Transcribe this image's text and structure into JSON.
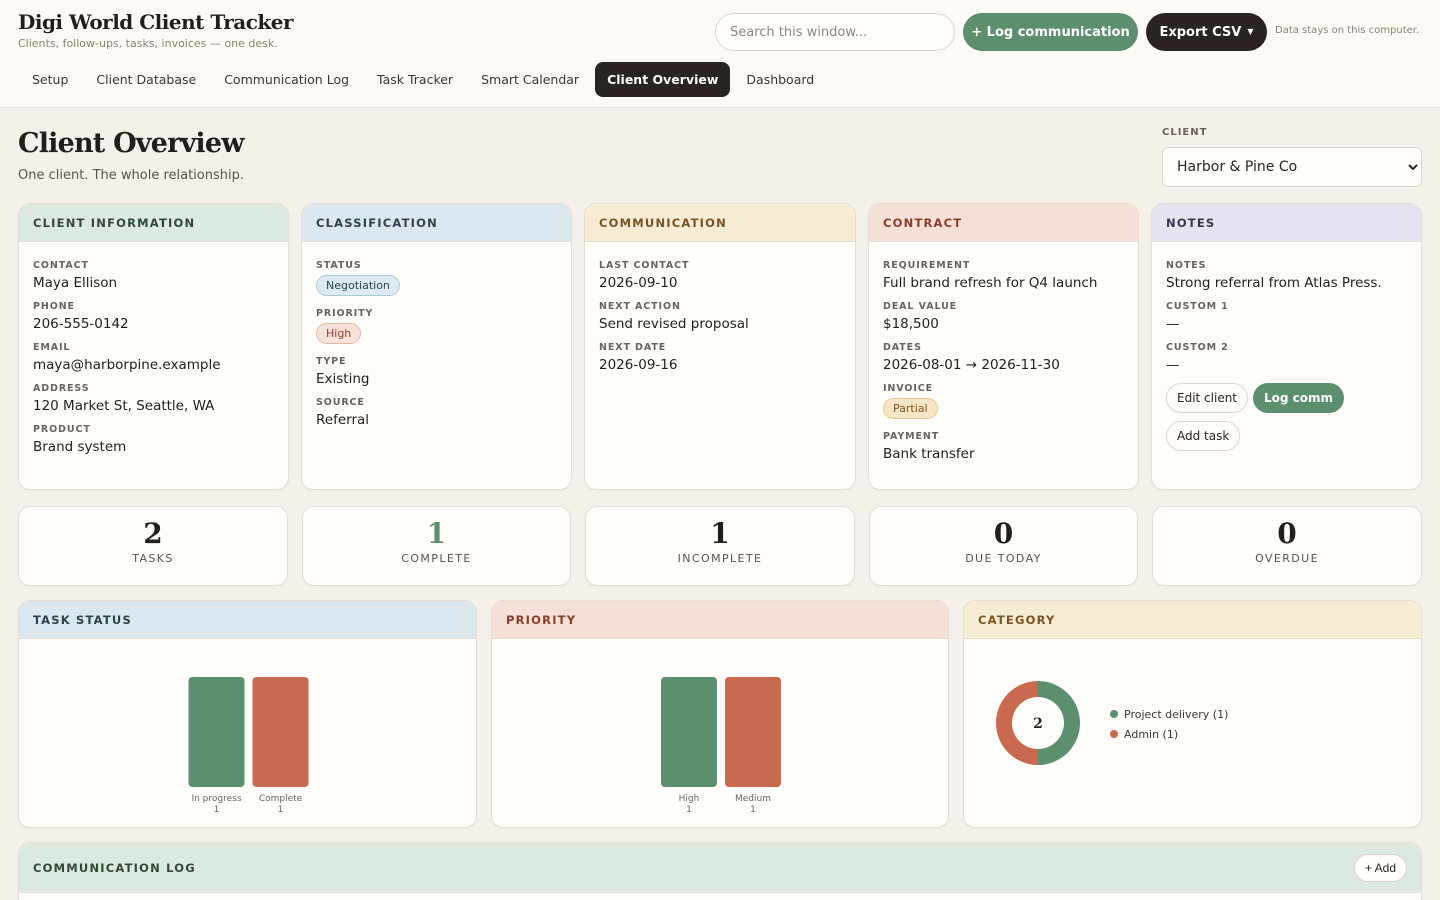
{
  "app": {
    "title": "Digi World Client Tracker",
    "subtitle": "Clients, follow-ups, tasks, invoices — one desk.",
    "search_placeholder": "Search this window...",
    "log_button": "+ Log communication",
    "export_button": "Export CSV",
    "local_note": "Data stays on this computer."
  },
  "nav": [
    {
      "label": "Setup",
      "active": false
    },
    {
      "label": "Client Database",
      "active": false
    },
    {
      "label": "Communication Log",
      "active": false
    },
    {
      "label": "Task Tracker",
      "active": false
    },
    {
      "label": "Smart Calendar",
      "active": false
    },
    {
      "label": "Client Overview",
      "active": true
    },
    {
      "label": "Dashboard",
      "active": false
    }
  ],
  "page": {
    "title": "Client Overview",
    "subtitle": "One client. The whole relationship.",
    "client_label": "CLIENT",
    "client_selected": "Harbor & Pine Co"
  },
  "info": {
    "header": "CLIENT INFORMATION",
    "contact_label": "CONTACT",
    "contact": "Maya Ellison",
    "phone_label": "PHONE",
    "phone": "206-555-0142",
    "email_label": "EMAIL",
    "email": "maya@harborpine.example",
    "address_label": "ADDRESS",
    "address": "120 Market St, Seattle, WA",
    "product_label": "PRODUCT",
    "product": "Brand system"
  },
  "classification": {
    "header": "CLASSIFICATION",
    "status_label": "STATUS",
    "status": "Negotiation",
    "priority_label": "PRIORITY",
    "priority": "High",
    "type_label": "TYPE",
    "type": "Existing",
    "source_label": "SOURCE",
    "source": "Referral"
  },
  "communication": {
    "header": "COMMUNICATION",
    "last_label": "LAST CONTACT",
    "last": "2026-09-10",
    "next_action_label": "NEXT ACTION",
    "next_action": "Send revised proposal",
    "next_date_label": "NEXT DATE",
    "next_date": "2026-09-16"
  },
  "contract": {
    "header": "CONTRACT",
    "requirement_label": "REQUIREMENT",
    "requirement": "Full brand refresh for Q4 launch",
    "deal_label": "DEAL VALUE",
    "deal": "$18,500",
    "dates_label": "DATES",
    "dates": "2026-08-01 → 2026-11-30",
    "invoice_label": "INVOICE",
    "invoice": "Partial",
    "payment_label": "PAYMENT",
    "payment": "Bank transfer"
  },
  "notes": {
    "header": "NOTES",
    "notes_label": "NOTES",
    "notes": "Strong referral from Atlas Press.",
    "custom1_label": "CUSTOM 1",
    "custom1": "—",
    "custom2_label": "CUSTOM 2",
    "custom2": "—",
    "edit_button": "Edit client",
    "log_button": "Log comm",
    "task_button": "Add task"
  },
  "stats": [
    {
      "value": "2",
      "label": "TASKS"
    },
    {
      "value": "1",
      "label": "COMPLETE"
    },
    {
      "value": "1",
      "label": "INCOMPLETE"
    },
    {
      "value": "0",
      "label": "DUE TODAY"
    },
    {
      "value": "0",
      "label": "OVERDUE"
    }
  ],
  "colors": {
    "green": "#5c8f6e",
    "red": "#c96a50"
  },
  "chart_data": [
    {
      "type": "bar",
      "title": "TASK STATUS",
      "categories": [
        "In progress",
        "Complete"
      ],
      "values": [
        1,
        1
      ],
      "colors": [
        "#5c8f6e",
        "#c96a50"
      ],
      "ylim": [
        0,
        1
      ]
    },
    {
      "type": "bar",
      "title": "PRIORITY",
      "categories": [
        "High",
        "Medium"
      ],
      "values": [
        1,
        1
      ],
      "colors": [
        "#5c8f6e",
        "#c96a50"
      ],
      "ylim": [
        0,
        1
      ]
    },
    {
      "type": "pie",
      "title": "CATEGORY",
      "center_label": "2",
      "categories": [
        "Project delivery",
        "Admin"
      ],
      "values": [
        1,
        1
      ],
      "legend": [
        "Project delivery (1)",
        "Admin (1)"
      ],
      "colors": [
        "#5c8f6e",
        "#c96a50"
      ]
    }
  ],
  "comm_log": {
    "header": "COMMUNICATION LOG",
    "add_button": "+ Add"
  }
}
